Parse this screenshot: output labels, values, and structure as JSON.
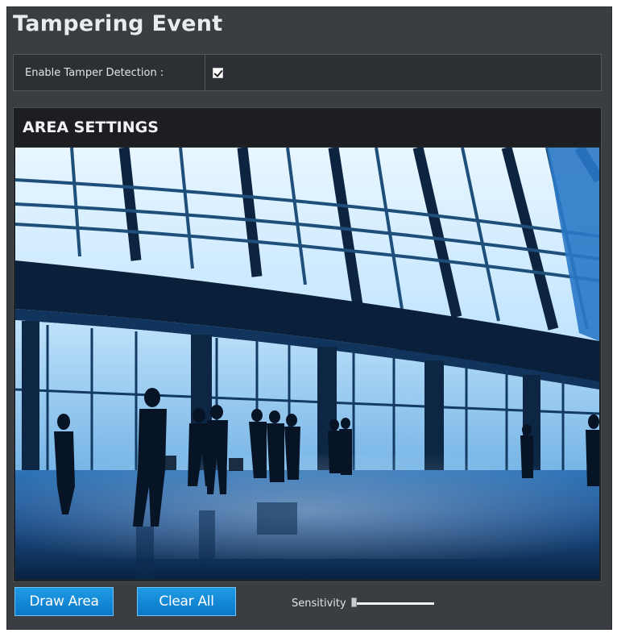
{
  "page": {
    "title": "Tampering Event"
  },
  "tamper": {
    "enable_label": "Enable Tamper Detection :",
    "enabled": true
  },
  "area_settings": {
    "header": "AREA SETTINGS",
    "preview": "camera-live-view"
  },
  "actions": {
    "draw_area_label": "Draw Area",
    "clear_all_label": "Clear All"
  },
  "sensitivity": {
    "label": "Sensitivity",
    "value_fraction": 0.0
  },
  "colors": {
    "background": "#3a3d42",
    "panel_header": "#1c1e21",
    "button": "#0a8ad6"
  }
}
